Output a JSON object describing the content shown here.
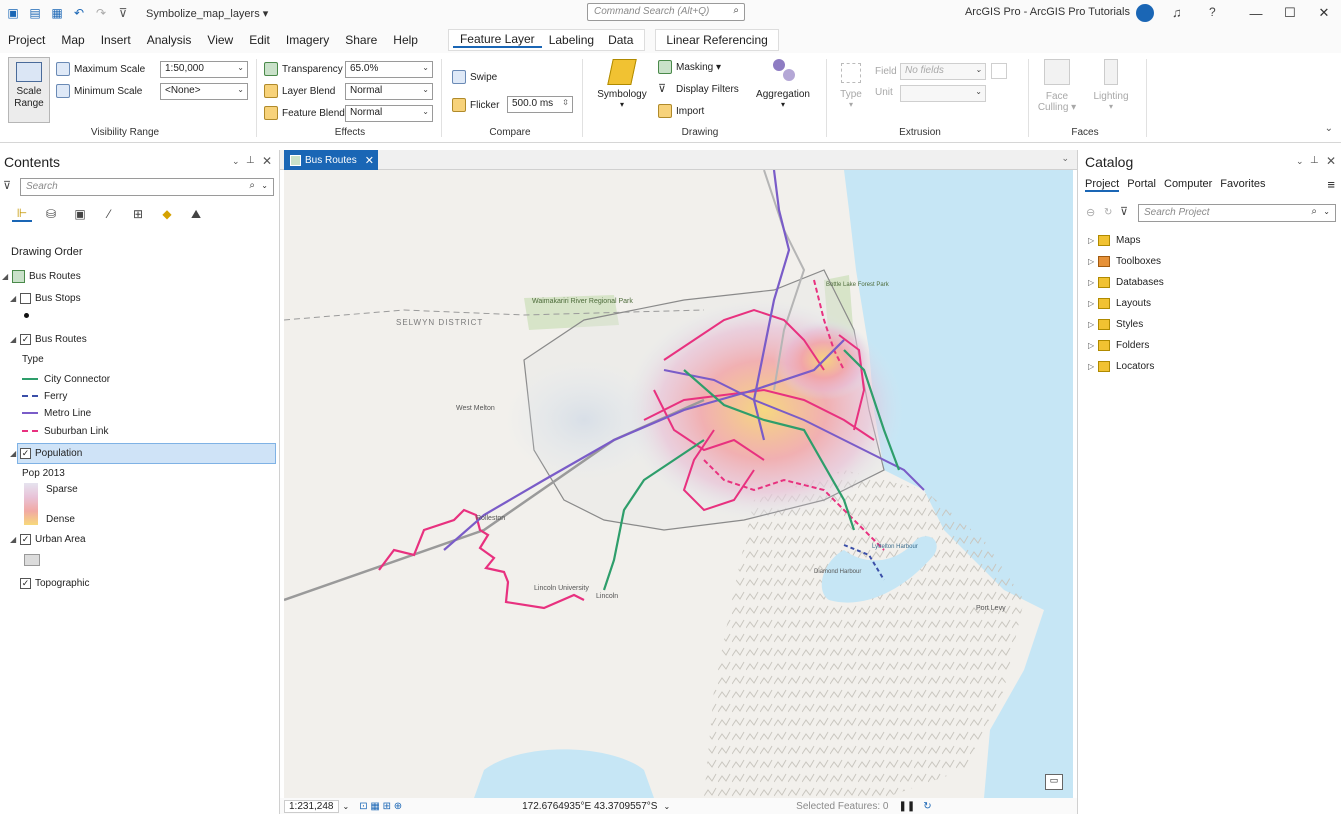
{
  "titlebar": {
    "doc_title": "Symbolize_map_layers ▾",
    "command_search": "Command Search (Alt+Q)",
    "app_title": "ArcGIS Pro - ArcGIS Pro Tutorials",
    "win_min": "—",
    "win_max": "☐",
    "win_close": "✕"
  },
  "menu": {
    "items": [
      "Project",
      "Map",
      "Insert",
      "Analysis",
      "View",
      "Edit",
      "Imagery",
      "Share",
      "Help"
    ],
    "ctx_tabs": [
      "Feature Layer",
      "Labeling",
      "Data"
    ],
    "linear_ref": "Linear Referencing"
  },
  "ribbon": {
    "scale_range": "Scale Range",
    "max_scale": "Maximum Scale",
    "max_scale_val": "1:50,000",
    "min_scale": "Minimum Scale",
    "min_scale_val": "<None>",
    "vis_range": "Visibility Range",
    "transparency": "Transparency",
    "transparency_val": "65.0%",
    "layer_blend": "Layer Blend",
    "layer_blend_val": "Normal",
    "feature_blend": "Feature Blend",
    "feature_blend_val": "Normal",
    "effects": "Effects",
    "swipe": "Swipe",
    "flicker": "Flicker",
    "flicker_val": "500.0",
    "flicker_unit": "ms",
    "compare": "Compare",
    "symbology": "Symbology",
    "masking": "Masking ▾",
    "display_filters": "Display Filters",
    "import": "Import",
    "aggregation": "Aggregation",
    "drawing": "Drawing",
    "type": "Type",
    "field": "Field",
    "field_val": "No fields",
    "unit": "Unit",
    "extrusion": "Extrusion",
    "face_culling": "Face Culling ▾",
    "lighting": "Lighting",
    "faces": "Faces"
  },
  "contents": {
    "title": "Contents",
    "search_placeholder": "Search",
    "drawing_order": "Drawing Order",
    "map_name": "Bus Routes",
    "bus_stops": "Bus Stops",
    "bus_routes": "Bus Routes",
    "type_label": "Type",
    "legend": [
      {
        "label": "City Connector",
        "color": "#2e9e6b",
        "style": "solid"
      },
      {
        "label": "Ferry",
        "color": "#3b4fa8",
        "style": "dashed"
      },
      {
        "label": "Metro Line",
        "color": "#7a5cc8",
        "style": "solid"
      },
      {
        "label": "Suburban Link",
        "color": "#e8317f",
        "style": "dashed"
      }
    ],
    "population": "Population",
    "pop_field": "Pop 2013",
    "sparse": "Sparse",
    "dense": "Dense",
    "urban_area": "Urban Area",
    "topographic": "Topographic"
  },
  "map": {
    "tab_label": "Bus Routes",
    "labels": [
      "Waimakariri River Regional Park",
      "Bottle Lake Forest Park",
      "SELWYN DISTRICT",
      "West Melton",
      "Rolleston",
      "Lincoln University",
      "Lincoln",
      "Lyttelton Harbour",
      "Port Levy",
      "Diamond Harbour"
    ]
  },
  "status": {
    "scale": "1:231,248",
    "coords": "172.6764935°E 43.3709557°S",
    "selected": "Selected Features: 0"
  },
  "catalog": {
    "title": "Catalog",
    "tabs": [
      "Project",
      "Portal",
      "Computer",
      "Favorites"
    ],
    "search_placeholder": "Search Project",
    "items": [
      "Maps",
      "Toolboxes",
      "Databases",
      "Layouts",
      "Styles",
      "Folders",
      "Locators"
    ]
  }
}
